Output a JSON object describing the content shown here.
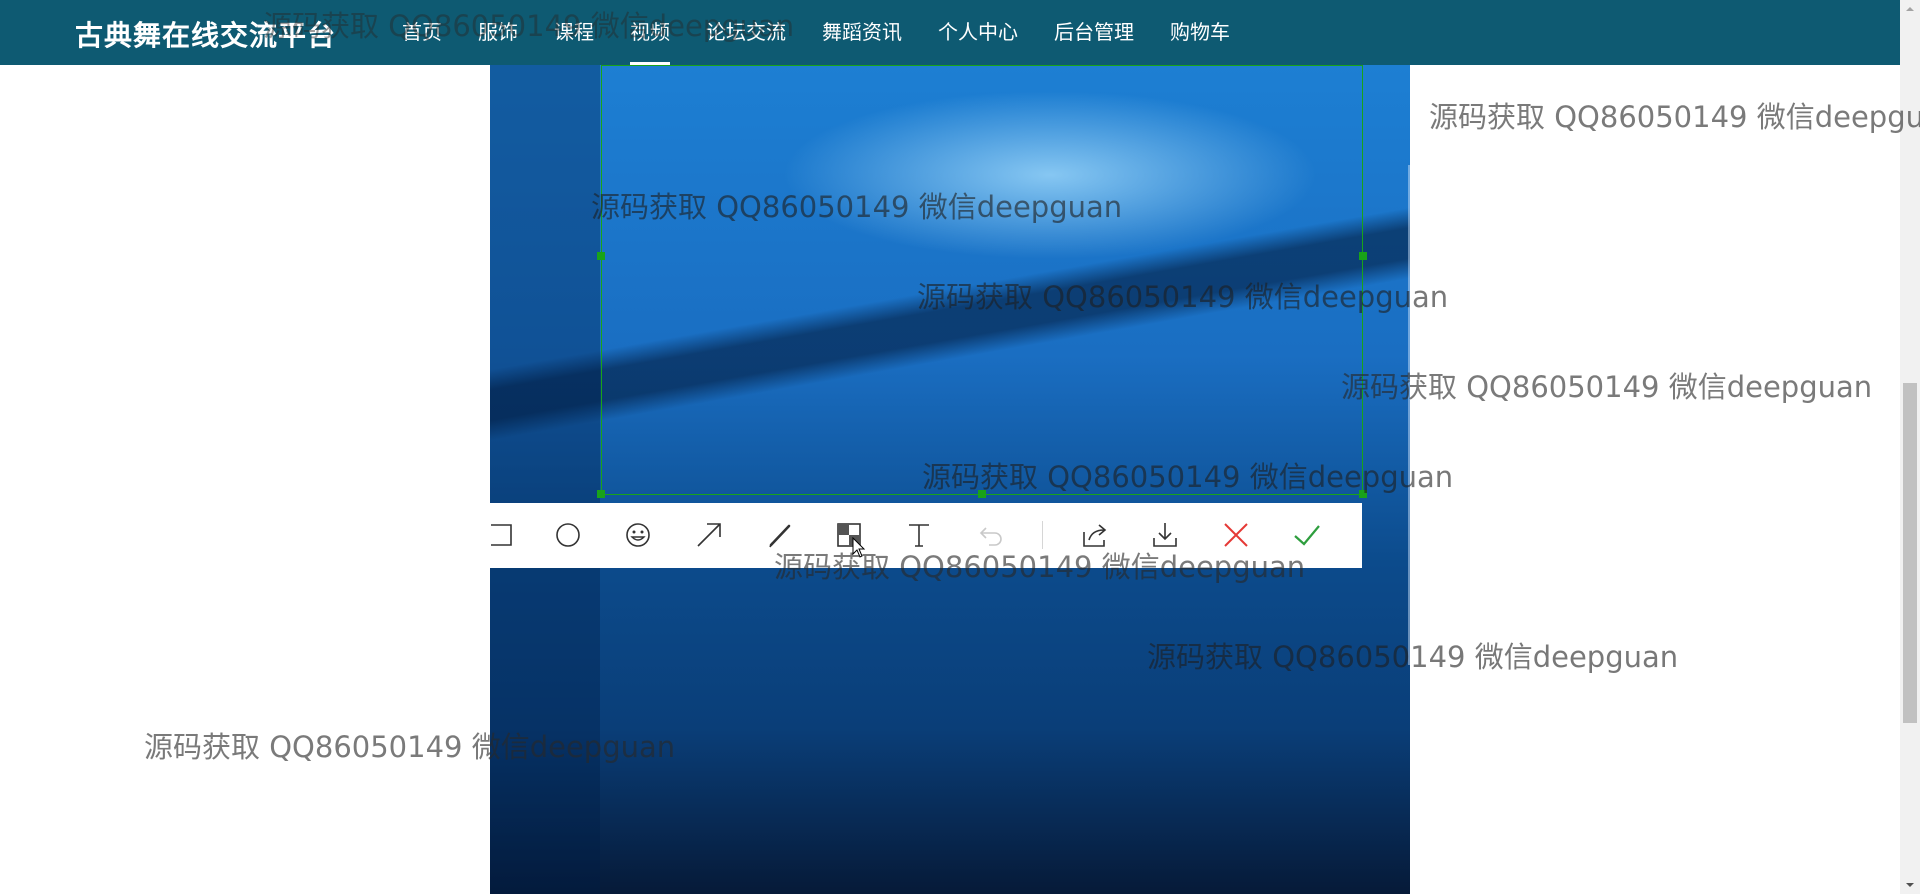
{
  "header": {
    "brand": "古典舞在线交流平台",
    "nav": [
      {
        "label": "首页",
        "active": false
      },
      {
        "label": "服饰",
        "active": false
      },
      {
        "label": "课程",
        "active": false
      },
      {
        "label": "视频",
        "active": true
      },
      {
        "label": "论坛交流",
        "active": false
      },
      {
        "label": "舞蹈资讯",
        "active": false
      },
      {
        "label": "个人中心",
        "active": false
      },
      {
        "label": "后台管理",
        "active": false
      },
      {
        "label": "购物车",
        "active": false
      }
    ]
  },
  "capture_toolbar": {
    "tools": [
      {
        "icon": "rectangle-icon"
      },
      {
        "icon": "ellipse-icon"
      },
      {
        "icon": "emoji-icon"
      },
      {
        "icon": "arrow-icon"
      },
      {
        "icon": "pen-icon"
      },
      {
        "icon": "mosaic-icon"
      },
      {
        "icon": "text-icon"
      },
      {
        "icon": "undo-icon"
      },
      {
        "icon": "share-icon"
      },
      {
        "icon": "download-icon"
      },
      {
        "icon": "close-icon"
      },
      {
        "icon": "confirm-icon"
      }
    ],
    "colors": {
      "cancel": "#e53935",
      "confirm": "#2e9e3e",
      "selection": "#19a319"
    }
  },
  "watermark": {
    "text": "源码获取 QQ86050149 微信deepguan"
  },
  "theme": {
    "navbar_bg": "#0e5a72"
  }
}
